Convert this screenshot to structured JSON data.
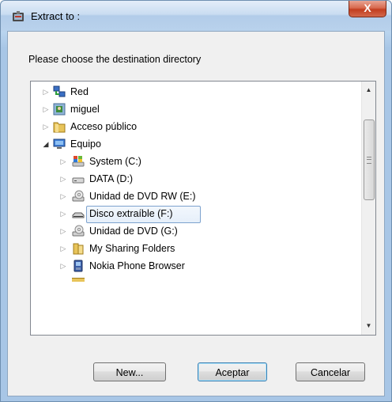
{
  "window": {
    "title": "Extract to :",
    "close_glyph": "X"
  },
  "prompt": "Please choose the destination directory",
  "tree": {
    "items": [
      {
        "label": "Red",
        "icon": "network-icon",
        "expander": "▷",
        "expanded": false,
        "selected": false,
        "level": 0
      },
      {
        "label": "miguel",
        "icon": "user-folder-icon",
        "expander": "▷",
        "expanded": false,
        "selected": false,
        "level": 0
      },
      {
        "label": "Acceso público",
        "icon": "public-folder-icon",
        "expander": "▷",
        "expanded": false,
        "selected": false,
        "level": 0
      },
      {
        "label": "Equipo",
        "icon": "computer-icon",
        "expander": "◢",
        "expanded": true,
        "selected": false,
        "level": 0
      },
      {
        "label": "System (C:)",
        "icon": "system-drive-icon",
        "expander": "▷",
        "expanded": false,
        "selected": false,
        "level": 1
      },
      {
        "label": "DATA (D:)",
        "icon": "hard-drive-icon",
        "expander": "▷",
        "expanded": false,
        "selected": false,
        "level": 1
      },
      {
        "label": "Unidad de DVD RW (E:)",
        "icon": "dvd-drive-icon",
        "expander": "▷",
        "expanded": false,
        "selected": false,
        "level": 1
      },
      {
        "label": "Disco extraíble (F:)",
        "icon": "removable-drive-icon",
        "expander": "▷",
        "expanded": false,
        "selected": true,
        "level": 1
      },
      {
        "label": "Unidad de DVD (G:)",
        "icon": "dvd-drive-icon",
        "expander": "▷",
        "expanded": false,
        "selected": false,
        "level": 1
      },
      {
        "label": "My Sharing Folders",
        "icon": "folder-icon",
        "expander": "▷",
        "expanded": false,
        "selected": false,
        "level": 1
      },
      {
        "label": "Nokia Phone Browser",
        "icon": "phone-browser-icon",
        "expander": "▷",
        "expanded": false,
        "selected": false,
        "level": 1
      }
    ]
  },
  "buttons": {
    "new_label": "New...",
    "accept_label": "Aceptar",
    "cancel_label": "Cancelar"
  },
  "colors": {
    "selection_border": "#7da2ce",
    "close_red": "#c23e1f"
  }
}
